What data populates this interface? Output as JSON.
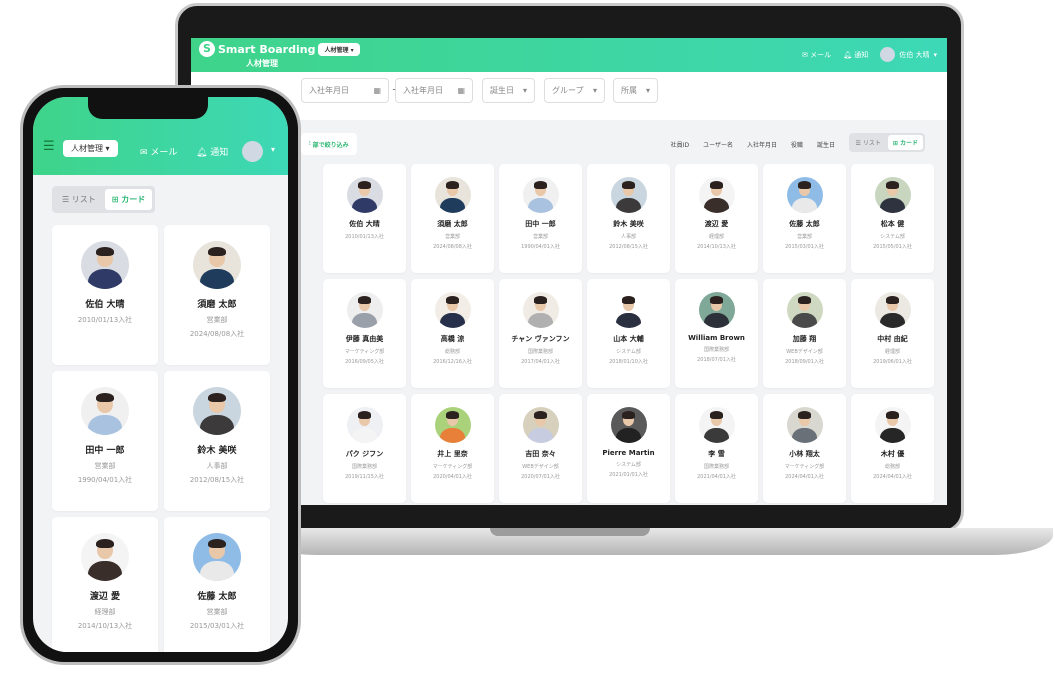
{
  "app": {
    "brand": "Smart Boarding",
    "module": "人材管理",
    "module_select": "人材管理",
    "mail": "メール",
    "notify": "通知",
    "user": "佐伯 大晴"
  },
  "colors": {
    "accent": "#2bb673",
    "header_start": "#3fd48a",
    "header_end": "#3dd8b6"
  },
  "filters": {
    "join_from": "入社年月日",
    "range_sep": "~",
    "join_to": "入社年月日",
    "birthday": "誕生日",
    "group": "グループ",
    "affiliation": "所属"
  },
  "toolbar": {
    "filter_button": "部で絞り込み",
    "sorts": [
      "社員ID",
      "ユーザー名",
      "入社年月日",
      "役職",
      "誕生日"
    ],
    "list": "リスト",
    "card": "カード"
  },
  "people": [
    {
      "name": "佐伯 大晴",
      "dept": "",
      "date": "2010/01/13入社",
      "bg": "#d9dde3",
      "suit": "#2f3b66"
    },
    {
      "name": "須磨 太郎",
      "dept": "営業部",
      "date": "2024/08/08入社",
      "bg": "#e8e4dc",
      "suit": "#1f3c5c"
    },
    {
      "name": "田中 一郎",
      "dept": "営業部",
      "date": "1990/04/01入社",
      "bg": "#f0f0f0",
      "suit": "#a9c2e0"
    },
    {
      "name": "鈴木 美咲",
      "dept": "人事部",
      "date": "2012/08/15入社",
      "bg": "#c9d6e0",
      "suit": "#3c3a3a"
    },
    {
      "name": "渡辺 愛",
      "dept": "経理部",
      "date": "2014/10/13入社",
      "bg": "#f4f4f4",
      "suit": "#3a2e2a"
    },
    {
      "name": "佐藤 太郎",
      "dept": "営業部",
      "date": "2015/03/01入社",
      "bg": "#8fbce6",
      "suit": "#e9e9e9"
    },
    {
      "name": "松本 健",
      "dept": "システム部",
      "date": "2015/05/01入社",
      "bg": "#c8d6c0",
      "suit": "#2f3340"
    },
    {
      "name": "伊藤 真由美",
      "dept": "マーケティング部",
      "date": "2016/09/05入社",
      "bg": "#eeeeee",
      "suit": "#9aa0aa"
    },
    {
      "name": "高橋 涼",
      "dept": "総務部",
      "date": "2016/12/16入社",
      "bg": "#f2ede6",
      "suit": "#26304a"
    },
    {
      "name": "チャン ヴァンフン",
      "dept": "国際業務部",
      "date": "2017/04/01入社",
      "bg": "#f0ebe4",
      "suit": "#b0b0b0"
    },
    {
      "name": "山本 大輔",
      "dept": "システム部",
      "date": "2018/01/10入社",
      "bg": "#ffffff",
      "suit": "#2a3040"
    },
    {
      "name": "William Brown",
      "dept": "国際業務部",
      "date": "2018/07/01入社",
      "bg": "#7fa898",
      "suit": "#2c3038"
    },
    {
      "name": "加藤 翔",
      "dept": "WEBデザイン部",
      "date": "2018/09/01入社",
      "bg": "#cfd8c0",
      "suit": "#4a4a4a"
    },
    {
      "name": "中村 由紀",
      "dept": "経理部",
      "date": "2019/06/01入社",
      "bg": "#ece8e2",
      "suit": "#2a2a2a"
    },
    {
      "name": "パク ジフン",
      "dept": "国際業務部",
      "date": "2019/11/15入社",
      "bg": "#eef0f4",
      "suit": "#f4f4f4"
    },
    {
      "name": "井上 里奈",
      "dept": "マーケティング部",
      "date": "2020/04/01入社",
      "bg": "#a9d27a",
      "suit": "#e8803a"
    },
    {
      "name": "吉田 奈々",
      "dept": "WEBデザイン部",
      "date": "2020/07/01入社",
      "bg": "#d6d0bc",
      "suit": "#c8cce0"
    },
    {
      "name": "Pierre Martin",
      "dept": "システム部",
      "date": "2021/01/01入社",
      "bg": "#5a5a5a",
      "suit": "#222222"
    },
    {
      "name": "李 雪",
      "dept": "国際業務部",
      "date": "2021/04/01入社",
      "bg": "#f4f4f4",
      "suit": "#3a3a3a"
    },
    {
      "name": "小林 翔太",
      "dept": "マーケティング部",
      "date": "2024/04/01入社",
      "bg": "#d8d8d0",
      "suit": "#6a7078"
    },
    {
      "name": "木村 優",
      "dept": "総務部",
      "date": "2024/04/01入社",
      "bg": "#f4f4f4",
      "suit": "#262626"
    }
  ]
}
